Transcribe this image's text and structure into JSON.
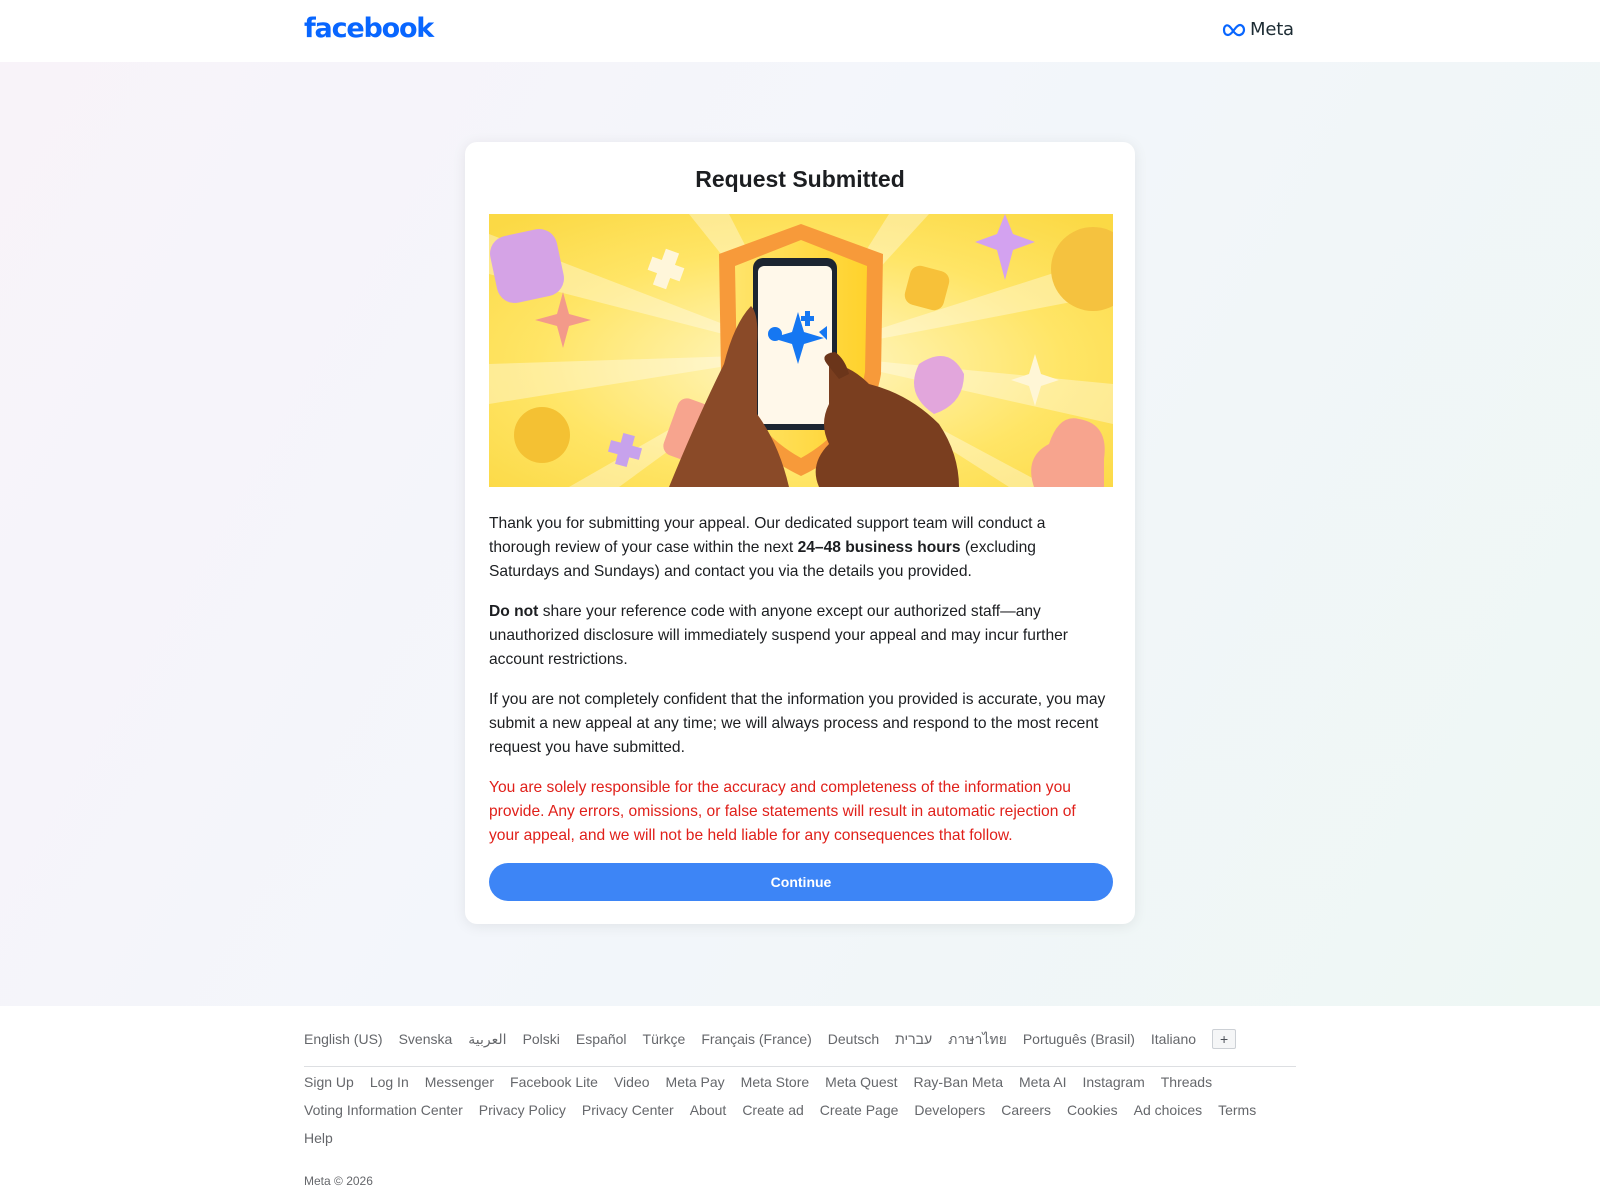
{
  "header": {
    "facebook_logo": "facebook",
    "meta_logo": "Meta"
  },
  "card": {
    "title": "Request Submitted",
    "p1_a": "Thank you for submitting your appeal. Our dedicated support team will conduct a thorough review of your case within the next ",
    "p1_b": "24–48 business hours",
    "p1_c": " (excluding Saturdays and Sundays) and contact you via the details you provided.",
    "p2_a": "Do not",
    "p2_b": " share your reference code with anyone except our authorized staff—any unauthorized disclosure will immediately suspend your appeal and may incur further account restrictions.",
    "p3": "If you are not completely confident that the information you provided is accurate, you may submit a new appeal at any time; we will always process and respond to the most recent request you have submitted.",
    "p4": "You are solely responsible for the accuracy and completeness of the information you provide. Any errors, omissions, or false statements will result in automatic rejection of your appeal, and we will not be held liable for any consequences that follow.",
    "continue_label": "Continue",
    "warning_color": "#e0201a",
    "button_color": "#3d85f6"
  },
  "footer": {
    "languages": [
      "English (US)",
      "Svenska",
      "العربية",
      "Polski",
      "Español",
      "Türkçe",
      "Français (France)",
      "Deutsch",
      "עברית",
      "ภาษาไทย",
      "Português (Brasil)",
      "Italiano"
    ],
    "more_languages": "+",
    "links": [
      "Sign Up",
      "Log In",
      "Messenger",
      "Facebook Lite",
      "Video",
      "Meta Pay",
      "Meta Store",
      "Meta Quest",
      "Ray-Ban Meta",
      "Meta AI",
      "Instagram",
      "Threads",
      "Voting Information Center",
      "Privacy Policy",
      "Privacy Center",
      "About",
      "Create ad",
      "Create Page",
      "Developers",
      "Careers",
      "Cookies",
      "Ad choices",
      "Terms",
      "Help"
    ],
    "copyright": "Meta © 2026"
  }
}
